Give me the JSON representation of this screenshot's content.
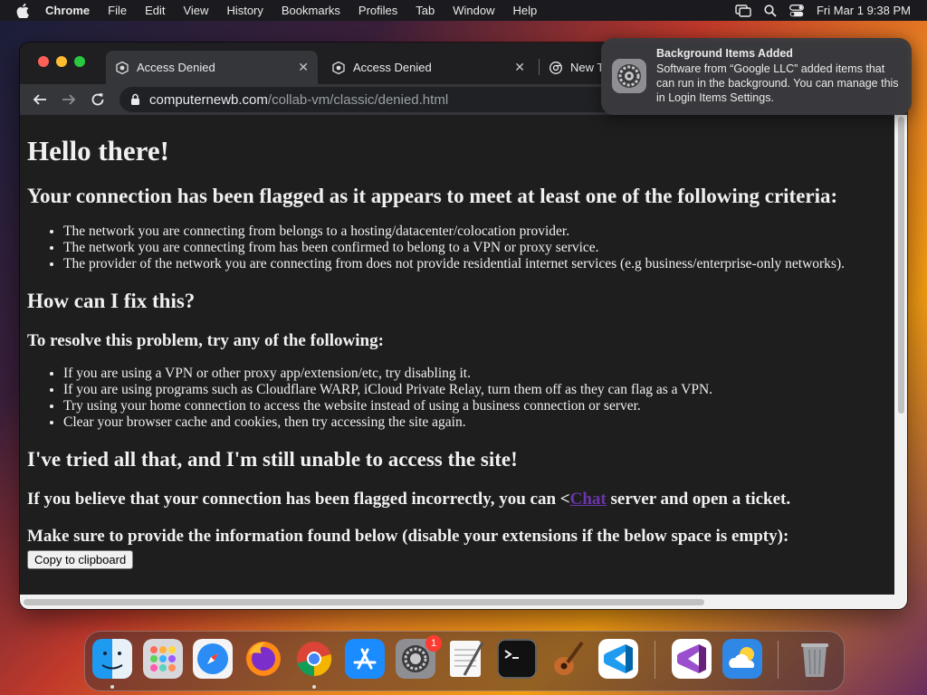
{
  "menubar": {
    "app_name": "Chrome",
    "items": [
      "File",
      "Edit",
      "View",
      "History",
      "Bookmarks",
      "Profiles",
      "Tab",
      "Window",
      "Help"
    ],
    "clock": "Fri Mar 1  9:38 PM"
  },
  "browser": {
    "tabs": [
      {
        "title": "Access Denied",
        "active": true
      },
      {
        "title": "Access Denied",
        "active": false
      },
      {
        "title": "New T",
        "active": false
      }
    ],
    "url_host": "computernewb.com",
    "url_path": "/collab-vm/classic/denied.html"
  },
  "page": {
    "heading": "Hello there!",
    "flagged_heading": "Your connection has been flagged as it appears to meet at least one of the following criteria:",
    "criteria": [
      "The network you are connecting from belongs to a hosting/datacenter/colocation provider.",
      "The network you are connecting from has been confirmed to belong to a VPN or proxy service.",
      "The provider of the network you are connecting from does not provide residential internet services (e.g business/enterprise-only networks)."
    ],
    "fix_heading": "How can I fix this?",
    "resolve_heading": "To resolve this problem, try any of the following:",
    "fixes": [
      "If you are using a VPN or other proxy app/extension/etc, try disabling it.",
      "If you are using programs such as Cloudflare WARP, iCloud Private Relay, turn them off as they can flag as a VPN.",
      "Try using your home connection to access the website instead of using a business connection or server.",
      "Clear your browser cache and cookies, then try accessing the site again."
    ],
    "still_heading": "I've tried all that, and I'm still unable to access the site!",
    "incorrect_prefix": "If you believe that your connection has been flagged incorrectly, you can <",
    "chat_link": "Chat",
    "incorrect_suffix": " server and open a ticket.",
    "provide_info": "Make sure to provide the information found below (disable your extensions if the below space is empty):",
    "copy_button": "Copy to clipboard"
  },
  "notification": {
    "title": "Background Items Added",
    "body": "Software from “Google LLC” added items that can run in the background. You can manage this in Login Items Settings."
  },
  "dock": {
    "apps": [
      "Finder",
      "Launchpad",
      "Safari",
      "Firefox",
      "Google Chrome",
      "App Store",
      "System Settings",
      "TextEdit",
      "Terminal",
      "GarageBand",
      "Visual Studio Code",
      "Visual Studio",
      "Weather",
      "Trash"
    ],
    "settings_badge": "1"
  },
  "colors": {
    "page_background": "#1e1e1e",
    "link": "#6a35a8"
  }
}
